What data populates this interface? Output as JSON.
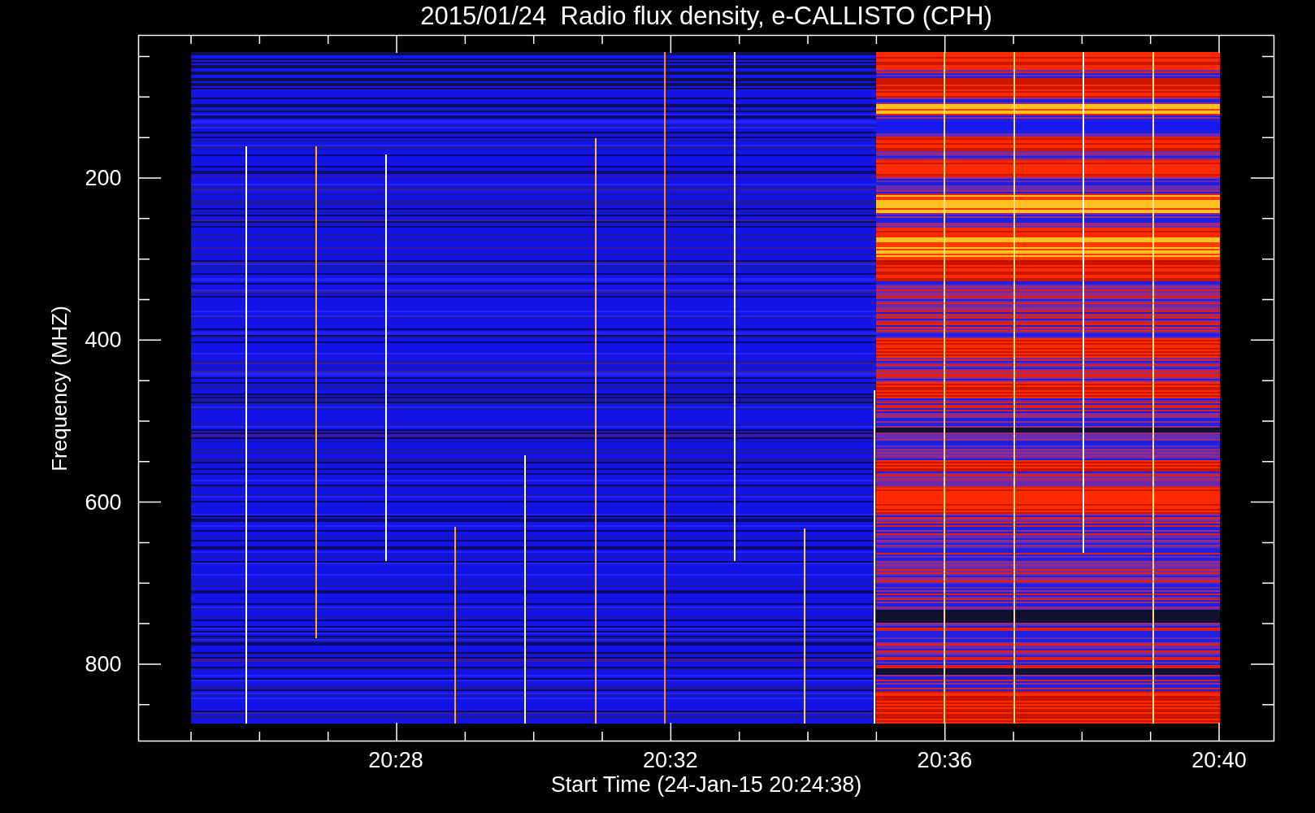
{
  "title": "2015/01/24  Radio flux density, e-CALLISTO (CPH)",
  "y_axis": {
    "label": "Frequency (MHZ)",
    "ticks": [
      "200",
      "400",
      "600",
      "800"
    ]
  },
  "x_axis": {
    "label": "Start Time (24-Jan-15 20:24:38)",
    "ticks": [
      "20:28",
      "20:32",
      "20:36",
      "20:40"
    ]
  }
}
